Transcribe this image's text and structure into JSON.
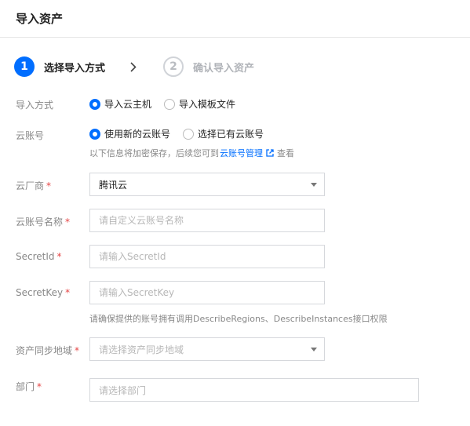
{
  "header": {
    "title": "导入资产"
  },
  "steps": [
    {
      "number": "1",
      "label": "选择导入方式",
      "state": "active"
    },
    {
      "number": "2",
      "label": "确认导入资产",
      "state": "inactive"
    }
  ],
  "form": {
    "import_method": {
      "label": "导入方式",
      "options": [
        "导入云主机",
        "导入模板文件"
      ],
      "selected": "导入云主机"
    },
    "cloud_account": {
      "label": "云账号",
      "options": [
        "使用新的云账号",
        "选择已有云账号"
      ],
      "selected": "使用新的云账号",
      "hint_prefix": "以下信息将加密保存，后续您可到",
      "hint_link": "云账号管理",
      "hint_suffix": "查看"
    },
    "provider": {
      "label": "云厂商",
      "required": "*",
      "value": "腾讯云"
    },
    "account_name": {
      "label": "云账号名称",
      "required": "*",
      "placeholder": "请自定义云账号名称"
    },
    "secret_id": {
      "label": "SecretId",
      "required": "*",
      "placeholder": "请输入SecretId"
    },
    "secret_key": {
      "label": "SecretKey",
      "required": "*",
      "placeholder": "请输入SecretKey",
      "hint": "请确保提供的账号拥有调用DescribeRegions、DescribeInstances接口权限"
    },
    "sync_region": {
      "label": "资产同步地域",
      "required": "*",
      "placeholder": "请选择资产同步地域"
    },
    "department": {
      "label": "部门",
      "required": "*",
      "placeholder": "请选择部门"
    }
  },
  "colors": {
    "accent": "#006eff",
    "required": "#e54545",
    "border": "#d6d8dc"
  },
  "icons": {
    "step_separator": "chevron-right-icon",
    "external_link": "external-link-icon",
    "dropdown": "caret-down-icon"
  }
}
